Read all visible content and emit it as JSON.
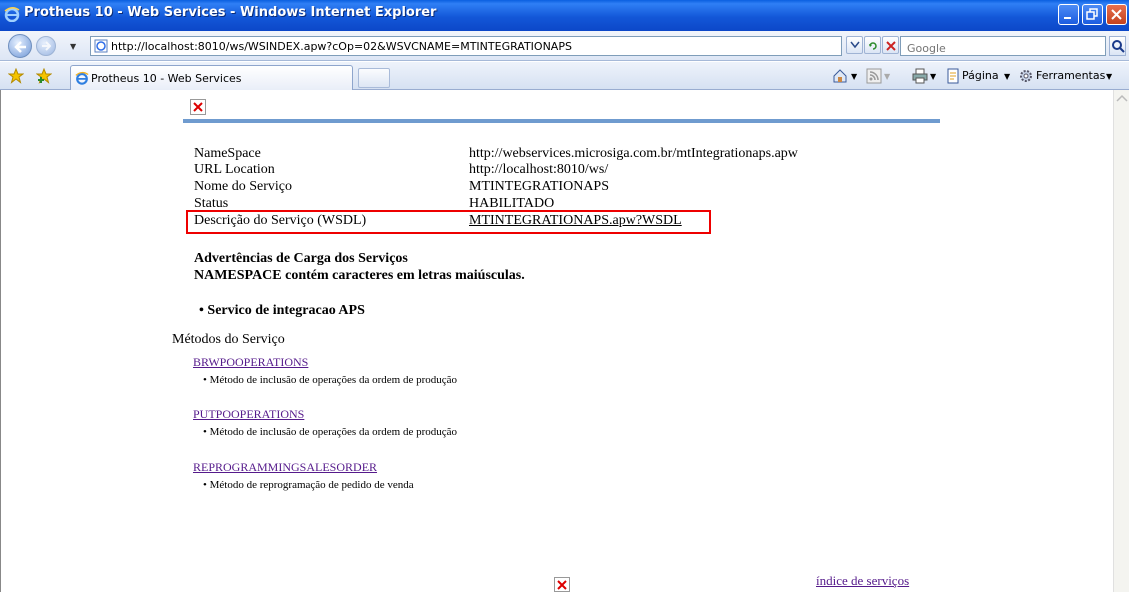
{
  "window": {
    "title": "Protheus 10 - Web Services - Windows Internet Explorer"
  },
  "address_bar": {
    "url": "http://localhost:8010/ws/WSINDEX.apw?cOp=02&WSVCNAME=MTINTEGRATIONAPS"
  },
  "search": {
    "placeholder": "Google"
  },
  "tabs": [
    {
      "label": "Protheus 10 - Web Services"
    }
  ],
  "command_bar": {
    "page_label": "Página",
    "tools_label": "Ferramentas"
  },
  "service_info": {
    "rows": [
      {
        "label": "NameSpace",
        "value": "http://webservices.microsiga.com.br/mtIntegrationaps.apw"
      },
      {
        "label": "URL Location",
        "value": "http://localhost:8010/ws/"
      },
      {
        "label": "Nome do Serviço",
        "value": "MTINTEGRATIONAPS"
      },
      {
        "label": "Status",
        "value": "HABILITADO"
      },
      {
        "label": "Descrição do Serviço (WSDL)",
        "value": "MTINTEGRATIONAPS.apw?WSDL"
      }
    ]
  },
  "warnings": {
    "title": "Advertências de Carga dos Serviços",
    "message": "NAMESPACE contém caracteres em letras maiúsculas."
  },
  "service_desc": "• Servico de integracao APS",
  "methods": {
    "title": "Métodos do Serviço",
    "items": [
      {
        "name": "BRWPOOPERATIONS",
        "desc": "• Método de inclusão de operações da ordem de produção"
      },
      {
        "name": "PUTPOOPERATIONS",
        "desc": "• Método de inclusão de operações da ordem de produção"
      },
      {
        "name": "REPROGRAMMINGSALESORDER",
        "desc": "• Método de reprogramação de pedido de venda"
      }
    ]
  },
  "index_link": "índice de serviços"
}
